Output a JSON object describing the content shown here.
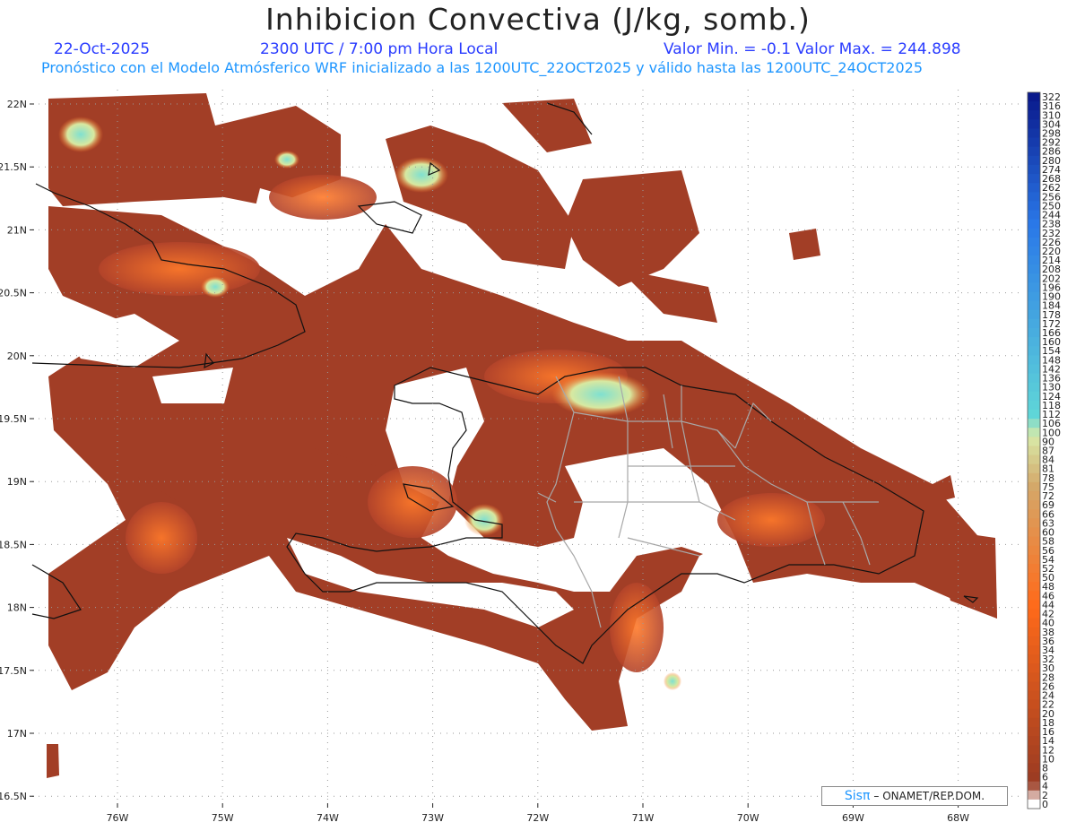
{
  "header": {
    "title": "Inhibicion Convectiva (J/kg, somb.)",
    "date": "22-Oct-2025",
    "time": "2300 UTC / 7:00 pm Hora Local",
    "minmax": "Valor Min. = -0.1  Valor Max. = 244.898",
    "model_line": "Pronóstico con el Modelo Atmósferico WRF inicializado a las 1200UTC_22OCT2025 y válido hasta las  1200UTC_24OCT2025"
  },
  "map": {
    "lat_labels": [
      "22N",
      "21.5N",
      "21N",
      "20.5N",
      "20N",
      "19.5N",
      "19N",
      "18.5N",
      "18N",
      "17.5N",
      "17N",
      "16.5N"
    ],
    "lon_labels": [
      "76W",
      "75W",
      "74W",
      "73W",
      "72W",
      "71W",
      "70W",
      "69W",
      "68W"
    ]
  },
  "colorbar": {
    "labels": [
      "322",
      "316",
      "310",
      "304",
      "298",
      "292",
      "286",
      "280",
      "274",
      "268",
      "262",
      "256",
      "250",
      "244",
      "238",
      "232",
      "226",
      "220",
      "214",
      "208",
      "202",
      "196",
      "190",
      "184",
      "178",
      "172",
      "166",
      "160",
      "154",
      "148",
      "142",
      "136",
      "130",
      "124",
      "118",
      "112",
      "106",
      "100",
      "90",
      "87",
      "84",
      "81",
      "78",
      "75",
      "72",
      "69",
      "66",
      "63",
      "60",
      "58",
      "56",
      "54",
      "52",
      "50",
      "48",
      "46",
      "44",
      "42",
      "40",
      "38",
      "36",
      "34",
      "32",
      "30",
      "28",
      "26",
      "24",
      "22",
      "20",
      "18",
      "16",
      "14",
      "12",
      "10",
      "8",
      "6",
      "4",
      "2",
      "0"
    ],
    "colors": {
      "high": "#0a1a8c",
      "mid_high": "#2a78e8",
      "cyan": "#5fd6d8",
      "light_green": "#d8eaa8",
      "tan": "#d4a86a",
      "orange": "#ff6a1a",
      "brown": "#9a3a22",
      "zero": "#ffffff"
    }
  },
  "credit": {
    "logo_text": "Sisπ",
    "org": "– ONAMET/REP.DOM."
  }
}
